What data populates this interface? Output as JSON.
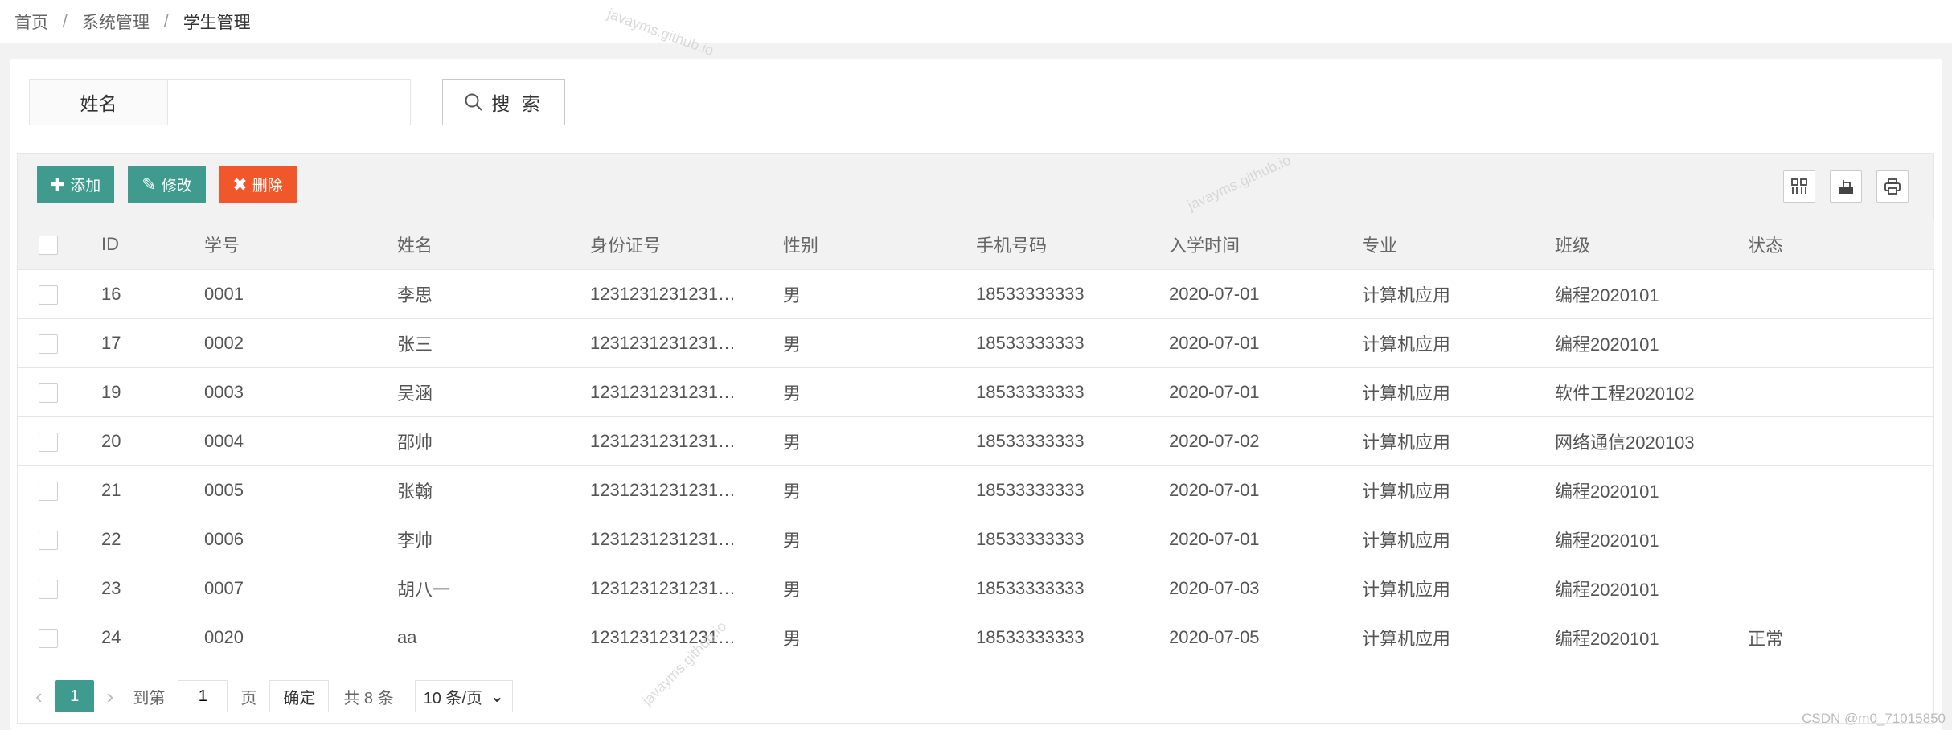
{
  "breadcrumb": {
    "items": [
      "首页",
      "系统管理",
      "学生管理"
    ],
    "separator": "/"
  },
  "search": {
    "label": "姓名",
    "value": "",
    "button_label": "搜 索"
  },
  "toolbar": {
    "add_label": "添加",
    "edit_label": "修改",
    "delete_label": "删除",
    "add_color": "#3f9b8e",
    "delete_color": "#f0582b"
  },
  "table": {
    "columns": [
      "ID",
      "学号",
      "姓名",
      "身份证号",
      "性别",
      "手机号码",
      "入学时间",
      "专业",
      "班级",
      "状态"
    ],
    "rows": [
      [
        "16",
        "0001",
        "李思",
        "1231231231231…",
        "男",
        "18533333333",
        "2020-07-01",
        "计算机应用",
        "编程2020101",
        ""
      ],
      [
        "17",
        "0002",
        "张三",
        "1231231231231…",
        "男",
        "18533333333",
        "2020-07-01",
        "计算机应用",
        "编程2020101",
        ""
      ],
      [
        "19",
        "0003",
        "吴涵",
        "1231231231231…",
        "男",
        "18533333333",
        "2020-07-01",
        "计算机应用",
        "软件工程2020102",
        ""
      ],
      [
        "20",
        "0004",
        "邵帅",
        "1231231231231…",
        "男",
        "18533333333",
        "2020-07-02",
        "计算机应用",
        "网络通信2020103",
        ""
      ],
      [
        "21",
        "0005",
        "张翰",
        "1231231231231…",
        "男",
        "18533333333",
        "2020-07-01",
        "计算机应用",
        "编程2020101",
        ""
      ],
      [
        "22",
        "0006",
        "李帅",
        "1231231231231…",
        "男",
        "18533333333",
        "2020-07-01",
        "计算机应用",
        "编程2020101",
        ""
      ],
      [
        "23",
        "0007",
        "胡八一",
        "1231231231231…",
        "男",
        "18533333333",
        "2020-07-03",
        "计算机应用",
        "编程2020101",
        ""
      ],
      [
        "24",
        "0020",
        "aa",
        "1231231231231…",
        "男",
        "18533333333",
        "2020-07-05",
        "计算机应用",
        "编程2020101",
        "正常"
      ]
    ]
  },
  "pager": {
    "current_page": "1",
    "goto_prefix": "到第",
    "goto_value": "1",
    "goto_suffix": "页",
    "confirm_label": "确定",
    "total_text": "共 8 条",
    "page_size": "10 条/页",
    "accent_color": "#3f9b8e"
  },
  "watermark_text": "javayms.github.io",
  "footer_credit": "CSDN @m0_71015850"
}
